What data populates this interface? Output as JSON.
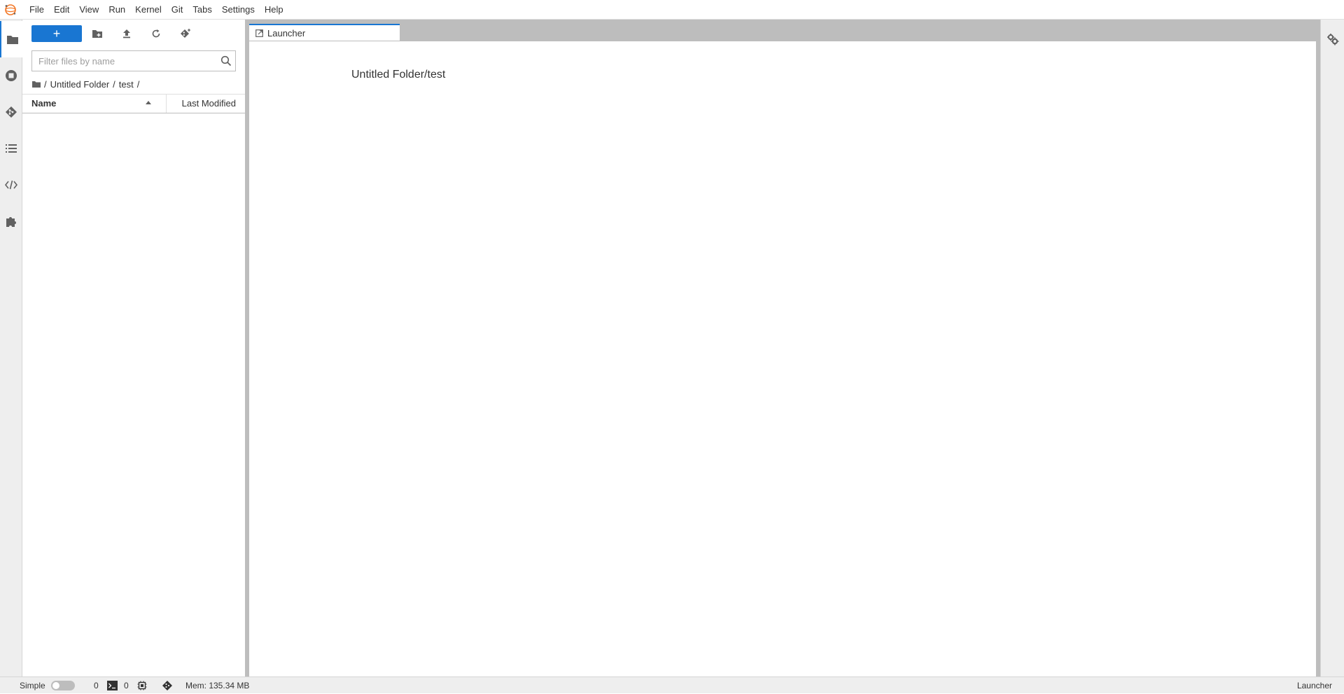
{
  "menubar": {
    "items": [
      "File",
      "Edit",
      "View",
      "Run",
      "Kernel",
      "Git",
      "Tabs",
      "Settings",
      "Help"
    ]
  },
  "left_sidebar": {
    "icons": [
      "folder-icon",
      "running-stop-icon",
      "git-icon",
      "table-of-contents-icon",
      "property-inspector-icon",
      "extension-manager-icon"
    ]
  },
  "filebrowser": {
    "new_button_label": "+",
    "filter_placeholder": "Filter files by name",
    "filter_value": "",
    "breadcrumb": [
      "Untitled Folder",
      "test"
    ],
    "breadcrumb_separator": "/",
    "columns": {
      "name": "Name",
      "last_modified": "Last Modified"
    },
    "files": []
  },
  "main": {
    "tabs": [
      {
        "label": "Launcher",
        "active": true
      }
    ],
    "launcher_cwd": "Untitled Folder/test"
  },
  "statusbar": {
    "mode_label": "Simple",
    "simple_mode": false,
    "kernels_count": "0",
    "terminals_count": "0",
    "memory": "Mem: 135.34 MB",
    "current_activity": "Launcher"
  },
  "colors": {
    "accent": "#1976d2",
    "sidebar_bg": "#eeeeee",
    "dock_bg": "#bdbdbd",
    "logo_orange": "#f37726"
  }
}
